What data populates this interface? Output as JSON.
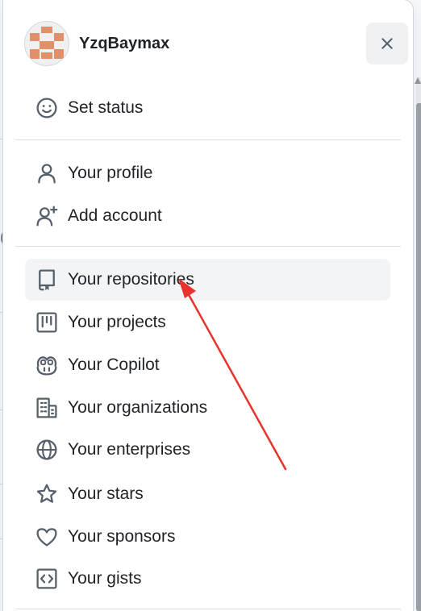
{
  "user": {
    "username": "YzqBaymax"
  },
  "menu": {
    "status": {
      "label": "Set status",
      "icon": "smiley-icon"
    },
    "account": [
      {
        "label": "Your profile",
        "icon": "person-icon"
      },
      {
        "label": "Add account",
        "icon": "person-add-icon"
      }
    ],
    "items": [
      {
        "label": "Your repositories",
        "icon": "repo-icon",
        "active": true
      },
      {
        "label": "Your projects",
        "icon": "project-icon"
      },
      {
        "label": "Your Copilot",
        "icon": "copilot-icon"
      },
      {
        "label": "Your organizations",
        "icon": "organization-icon"
      },
      {
        "label": "Your enterprises",
        "icon": "globe-icon"
      },
      {
        "label": "Your stars",
        "icon": "star-icon"
      },
      {
        "label": "Your sponsors",
        "icon": "heart-icon"
      },
      {
        "label": "Your gists",
        "icon": "code-square-icon"
      }
    ]
  },
  "colors": {
    "active_bg": "#f3f4f6",
    "annotation_arrow": "#e8322c",
    "avatar_primary": "#e0916c"
  },
  "background": {
    "partial_glyph": "("
  }
}
